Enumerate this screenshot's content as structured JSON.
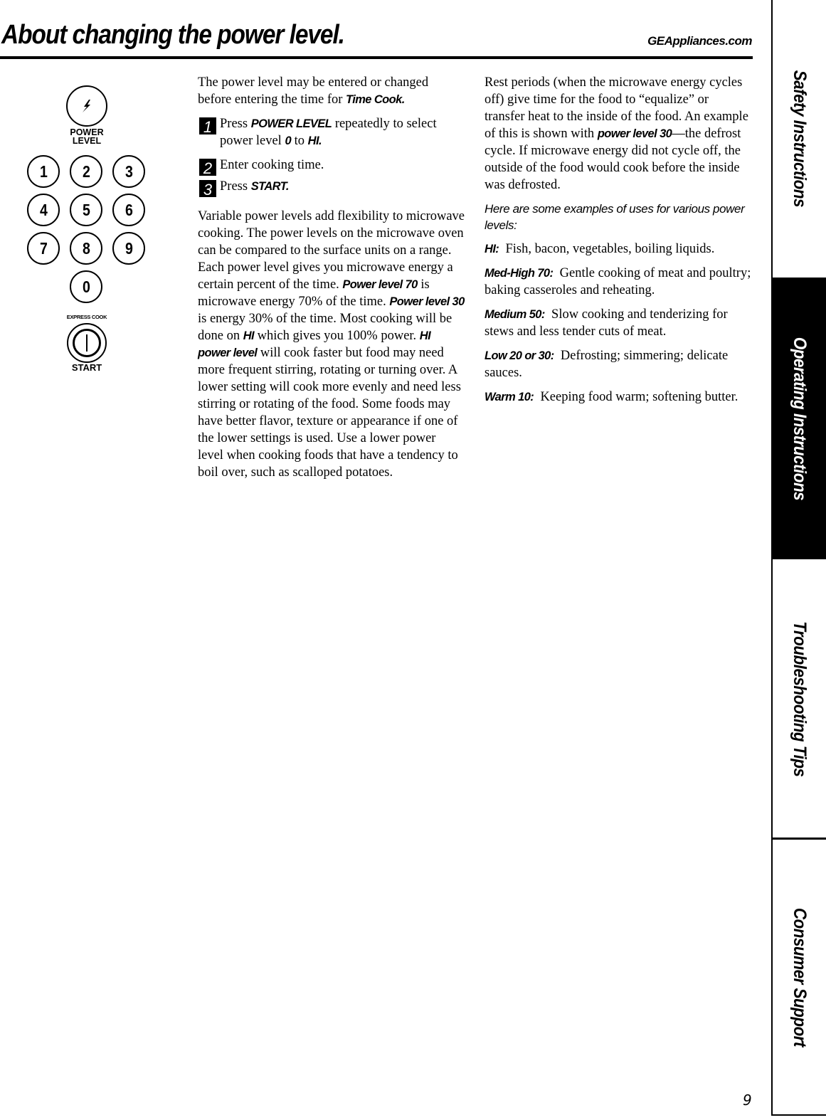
{
  "header": {
    "title": "About changing the power level.",
    "site": "GEAppliances.com"
  },
  "keypad": {
    "power_label_line1": "POWER",
    "power_label_line2": "LEVEL",
    "power_icon": "lightning-bolt-icon",
    "digits": [
      "1",
      "2",
      "3",
      "4",
      "5",
      "6",
      "7",
      "8",
      "9",
      "0"
    ],
    "express_cook_label": "EXPRESS COOK",
    "start_label": "START",
    "start_icon": "power-symbol-icon"
  },
  "middle_column": {
    "intro": {
      "text": "The power level may be entered or changed before entering the time for ",
      "emphasis": "Time Cook."
    },
    "steps": [
      {
        "number": "1",
        "pre": "Press ",
        "emphasis1": "POWER LEVEL",
        "mid": " repeatedly to select power level ",
        "emphasis2": "0",
        "mid2": " to ",
        "emphasis3": "HI."
      },
      {
        "number": "2",
        "text": "Enter cooking time."
      },
      {
        "number": "3",
        "pre": "Press ",
        "emphasis": "START."
      }
    ],
    "body": {
      "t1": "Variable power levels add flexibility to microwave cooking. The power levels on the microwave oven can be compared to the surface units on a range. Each power level gives you microwave energy a certain percent of the time. ",
      "e1": "Power level 70",
      "t2": " is microwave energy 70% of the time. ",
      "e2": "Power level 30",
      "t3": " is energy 30% of the time. Most cooking will be done on ",
      "e3": "HI",
      "t4": " which gives you 100% power. ",
      "e4": "HI power level",
      "t5": " will cook faster but food may need more frequent stirring, rotating or turning over. A lower setting will cook more evenly and need less stirring or rotating of the food. Some foods may have better flavor, texture or appearance if one of the lower settings is used. Use a lower power level when cooking foods that have a tendency to boil over, such as scalloped potatoes."
    }
  },
  "right_column": {
    "rest": {
      "t1": "Rest periods (when the microwave energy cycles off) give time for the food to “equalize” or transfer heat to the inside of the food. An example of this is shown with ",
      "e1": "power level 30",
      "t2": "—the defrost cycle. If microwave energy did not cycle off, the outside of the food would cook before the inside was defrosted."
    },
    "examples_heading": "Here are some examples of uses for various power levels:",
    "examples": [
      {
        "level": "HI:",
        "use": "Fish, bacon, vegetables, boiling liquids."
      },
      {
        "level": "Med-High 70:",
        "use": "Gentle cooking of meat and poultry; baking casseroles and reheating."
      },
      {
        "level": "Medium 50:",
        "use": "Slow cooking and tenderizing for stews and less tender cuts of meat."
      },
      {
        "level": "Low 20 or 30:",
        "use": "Defrosting; simmering; delicate sauces."
      },
      {
        "level": "Warm 10:",
        "use": "Keeping food warm; softening butter."
      }
    ]
  },
  "side_tabs": [
    {
      "label": "Safety Instructions",
      "active": false
    },
    {
      "label": "Operating Instructions",
      "active": true
    },
    {
      "label": "Troubleshooting Tips",
      "active": false
    },
    {
      "label": "Consumer Support",
      "active": false
    }
  ],
  "page_number": "9"
}
